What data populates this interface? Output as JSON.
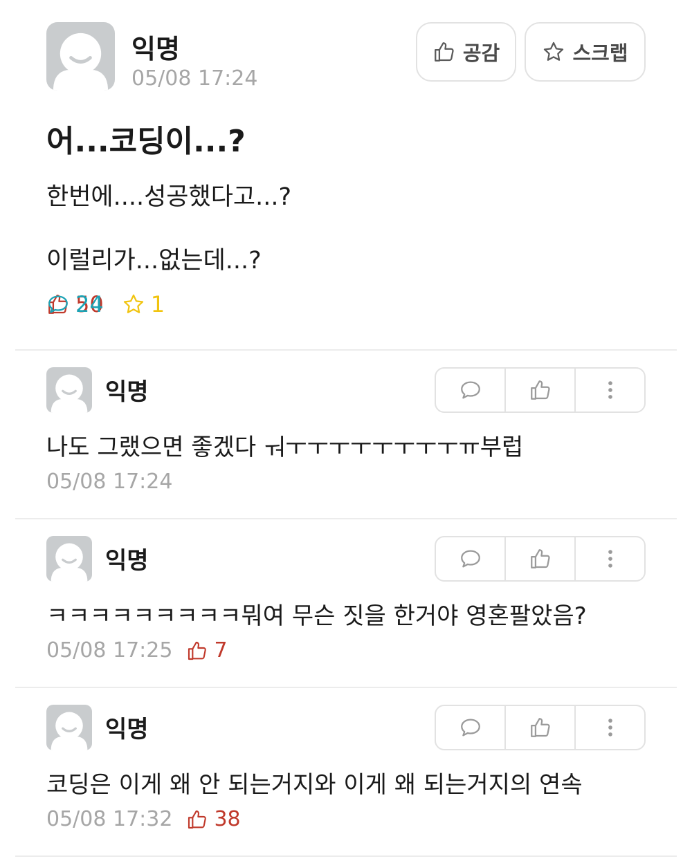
{
  "post": {
    "author": "익명",
    "time": "05/08 17:24",
    "like_button_label": "공감",
    "scrap_button_label": "스크랩",
    "title": "어...코딩이...?",
    "body": [
      "한번에....성공했다고...?",
      "이럴리가...없는데...?"
    ],
    "stats": {
      "likes": "50",
      "comments": "24",
      "scraps": "1"
    }
  },
  "comments": [
    {
      "author": "익명",
      "text": "나도 그랬으면 좋겠다 ㅝㅜㅜㅜㅜㅜㅜㅜㅜㅠ부럽",
      "time": "05/08 17:24",
      "likes": ""
    },
    {
      "author": "익명",
      "text": "ㅋㅋㅋㅋㅋㅋㅋㅋㅋ뭐여 무슨 짓을 한거야 영혼팔았음?",
      "time": "05/08 17:25",
      "likes": "7"
    },
    {
      "author": "익명",
      "text": "코딩은 이게 왜 안 되는거지와 이게 왜 되는거지의 연속",
      "time": "05/08 17:32",
      "likes": "38"
    }
  ],
  "colors": {
    "like": "#c0392b",
    "comment": "#1ba3b5",
    "scrap": "#f1c40f",
    "muted": "#a6a6a6"
  },
  "icons": [
    "avatar-icon",
    "thumbs-up-icon",
    "star-icon",
    "speech-bubble-icon",
    "more-vertical-icon"
  ]
}
